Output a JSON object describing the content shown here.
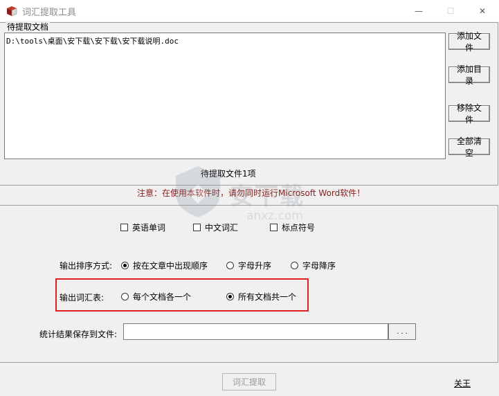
{
  "window": {
    "title": "词汇提取工具",
    "controls": {
      "minimize": "—",
      "maximize": "☐",
      "close": "✕"
    }
  },
  "files": {
    "group_label": "待提取文档",
    "items": [
      "D:\\tools\\桌面\\安下载\\安下载\\安下载说明.doc"
    ],
    "count_text": "待提取文件1项"
  },
  "buttons": {
    "add_file": "添加文件",
    "add_dir": "添加目录",
    "remove_file": "移除文件",
    "clear_all": "全部清空",
    "browse": ". . .",
    "extract": "词汇提取",
    "close": "关王"
  },
  "notice": "注意：在使用本软件时，请勿同时运行Microsoft Word软件！",
  "extract_types": {
    "english_words": {
      "label": "英语单词",
      "checked": false
    },
    "chinese_words": {
      "label": "中文词汇",
      "checked": false
    },
    "punctuation": {
      "label": "标点符号",
      "checked": false
    }
  },
  "sort": {
    "label": "输出排序方式:",
    "options": [
      {
        "label": "按在文章中出现顺序",
        "checked": true
      },
      {
        "label": "字母升序",
        "checked": false
      },
      {
        "label": "字母降序",
        "checked": false
      }
    ]
  },
  "output_vocab": {
    "label": "输出词汇表:",
    "options": [
      {
        "label": "每个文档各一个",
        "checked": false
      },
      {
        "label": "所有文档共一个",
        "checked": true
      }
    ]
  },
  "save": {
    "label": "统计结果保存到文件:",
    "value": ""
  },
  "watermark": {
    "cn": "安下载",
    "en": "anxz.com"
  },
  "colors": {
    "notice": "#8b1a1a",
    "highlight": "#e02020"
  }
}
